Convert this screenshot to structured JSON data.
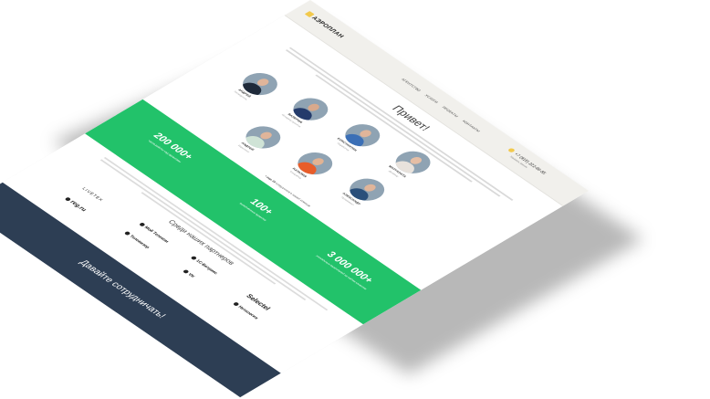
{
  "header": {
    "logo": "АЭРОПЛАН",
    "nav": [
      "АГЕНТСТВО",
      "УСЛУГИ",
      "ПРОЕКТЫ",
      "КОНТАКТЫ"
    ],
    "phone": "+7 (915) 222-86-85",
    "phone_sub": "Заказать звонок"
  },
  "hello": "Привет!",
  "team": [
    {
      "name": "АНДРЕЙ",
      "role": "Руководитель"
    },
    {
      "name": "ВАЛЕРИЯ",
      "role": "Менеджер проектов"
    },
    {
      "name": "КОНСТАНТИН",
      "role": "Разработчик"
    },
    {
      "name": "МАРГАРИТА",
      "role": "Дизайнер"
    },
    {
      "name": "АНДРЕЙ",
      "role": "Маркетолог"
    },
    {
      "name": "НАТАЛИЯ",
      "role": "Копирайтер"
    },
    {
      "name": "АЛЕКСАНДР",
      "role": "Программист"
    }
  ],
  "team_caption_lead": "• еще 10",
  "team_caption_rest": "сотрудников в нашей команде",
  "stats": [
    {
      "num": "200 000+",
      "label": "часов работы над проектами"
    },
    {
      "num": "100+",
      "label": "выполненных проектов"
    },
    {
      "num": "3 000 000+",
      "label": "уникальных посетителей на сайтах клиентов"
    }
  ],
  "partners_title": "Среди наших партнеров",
  "partners": [
    "Selectel",
    "1С-Битрикс",
    "Мой Телеком",
    "Нетология",
    "LIVETEX",
    "Телевизор",
    "VK",
    "reg.ru"
  ],
  "cta": "Давайте сотрудничать!",
  "colors": {
    "accent": "#22c26a",
    "cta": "#2d3e54",
    "logo": "#f2c94c"
  }
}
